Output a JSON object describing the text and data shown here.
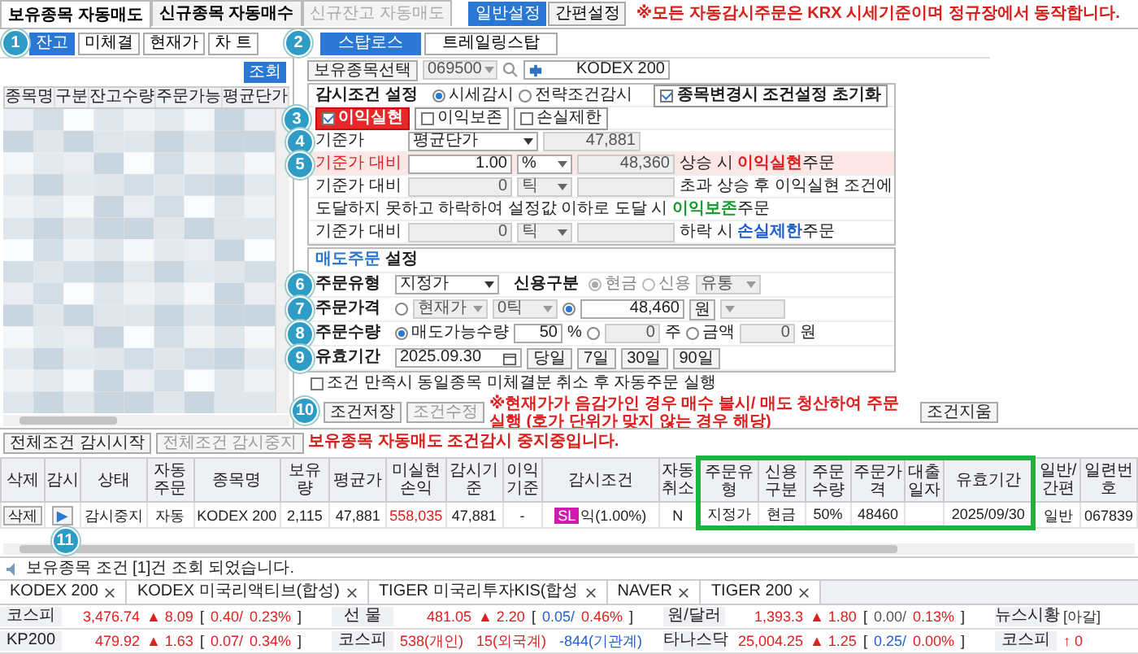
{
  "top_tabs": [
    {
      "label": "보유종목 자동매도",
      "selected": true,
      "disabled": false
    },
    {
      "label": "신규종목 자동매수",
      "selected": false,
      "disabled": false
    },
    {
      "label": "신규잔고 자동매도",
      "selected": false,
      "disabled": true
    }
  ],
  "mode_tabs": [
    {
      "label": "일반설정",
      "selected": true
    },
    {
      "label": "간편설정",
      "selected": false
    }
  ],
  "notice": "※모든 자동감시주문은 KRX 시세기준이며 정규장에서 동작합니다.",
  "left": {
    "tabs": [
      {
        "label": "잔고",
        "selected": true,
        "callout": "1"
      },
      {
        "label": "미체결",
        "selected": false
      },
      {
        "label": "현재가",
        "selected": false
      },
      {
        "label": "차 트",
        "selected": false
      }
    ],
    "query_button": "조회",
    "columns": [
      "종목명",
      "구분",
      "잔고수량",
      "주문가능",
      "평균단가"
    ]
  },
  "stop": {
    "tabs": [
      {
        "label": "스탑로스",
        "selected": true
      },
      {
        "label": "트레일링스탑",
        "selected": false
      }
    ],
    "tabs_callout": "2",
    "symbol": {
      "button": "보유종목선택",
      "code": "069500",
      "name": "KODEX 200"
    },
    "watch": {
      "title": "감시조건 설정",
      "modes": [
        {
          "label": "시세감시",
          "selected": true
        },
        {
          "label": "전략조건감시",
          "selected": false
        }
      ],
      "reset": {
        "label": "종목변경시 조건설정 초기화",
        "checked": true
      },
      "types_callout": "3",
      "types": [
        {
          "label": "이익실현",
          "checked": true
        },
        {
          "label": "이익보존",
          "checked": false
        },
        {
          "label": "손실제한",
          "checked": false
        }
      ],
      "base": {
        "callout": "4",
        "label": "기준가",
        "select": "평균단가",
        "value": "47,881"
      },
      "rows": [
        {
          "kind": "rule",
          "callout": "5",
          "active": true,
          "label": "기준가 대비",
          "value": "1.00",
          "unit": "%",
          "result": "48,360",
          "lead": "상승 시",
          "term": "이익실현",
          "tail": "주문",
          "color": "#e02020"
        },
        {
          "kind": "rule",
          "active": false,
          "label": "기준가 대비",
          "value": "0",
          "unit": "틱",
          "lead": "초과 상승 후 이익실현 조건에"
        },
        {
          "kind": "note",
          "lead": "도달하지 못하고 하락하여 설정값 이하로 도달 시",
          "term": "이익보존",
          "tail": "주문",
          "color": "#1a9a30"
        },
        {
          "kind": "rule",
          "active": false,
          "label": "기준가 대비",
          "value": "0",
          "unit": "틱",
          "lead": "하락 시",
          "term": "손실제한",
          "tail": "주문",
          "color": "#2060d0"
        }
      ]
    },
    "order": {
      "title_term": "매도주문",
      "title": "설정",
      "type": {
        "callout": "6",
        "label": "주문유형",
        "value": "지정가"
      },
      "credit": {
        "label": "신용구분",
        "options": [
          {
            "label": "현금",
            "selected": true
          },
          {
            "label": "신용",
            "selected": false
          }
        ],
        "select": "유통"
      },
      "price": {
        "callout": "7",
        "label": "주문가격",
        "market_selected": false,
        "market_select": "현재가",
        "tick_select": "0틱",
        "fixed_selected": true,
        "value": "48,460",
        "unit": "원"
      },
      "qty": {
        "callout": "8",
        "label": "주문수량",
        "sellable": {
          "label": "매도가능수량",
          "selected": true,
          "value": "50",
          "unit": "%"
        },
        "shares": {
          "selected": false,
          "value": "0",
          "unit": "주"
        },
        "amount": {
          "label": "금액",
          "selected": false,
          "value": "0",
          "unit": "원"
        }
      },
      "expiry": {
        "callout": "9",
        "label": "유효기간",
        "date": "2025.09.30",
        "presets": [
          "당일",
          "7일",
          "30일",
          "90일"
        ]
      }
    },
    "auto_cancel": {
      "label": "조건 만족시 동일종목 미체결분 취소 후 자동주문 실행",
      "checked": false
    },
    "actions": {
      "callout": "10",
      "save": "조건저장",
      "edit": "조건수정",
      "warning": "※현재가가 음감가인 경우 매수 불시/ 매도 청산하여 주문 실행 (호가 단위가 맞지 않는 경우 해당)",
      "clear": "조건지움"
    }
  },
  "monitor": {
    "start": "전체조건 감시시작",
    "stop": "전체조건 감시중지",
    "message": "보유종목 자동매도 조건감시 중지중입니다."
  },
  "conditions": {
    "columns": [
      {
        "label": "삭제",
        "highlighted": false
      },
      {
        "label": "감시",
        "highlighted": false
      },
      {
        "label": "상태",
        "highlighted": false
      },
      {
        "label": "자동주문",
        "highlighted": false
      },
      {
        "label": "종목명",
        "highlighted": false
      },
      {
        "label": "보유량",
        "highlighted": false
      },
      {
        "label": "평균가",
        "highlighted": false
      },
      {
        "label": "미실현손익",
        "highlighted": false
      },
      {
        "label": "감시기준",
        "highlighted": false
      },
      {
        "label": "이익기준",
        "highlighted": false
      },
      {
        "label": "감시조건",
        "highlighted": false
      },
      {
        "label": "자동취소",
        "highlighted": false
      },
      {
        "label": "주문유형",
        "highlighted": true
      },
      {
        "label": "신용구분",
        "highlighted": true
      },
      {
        "label": "주문수량",
        "highlighted": true
      },
      {
        "label": "주문가격",
        "highlighted": true
      },
      {
        "label": "대출일자",
        "highlighted": true
      },
      {
        "label": "유효기간",
        "highlighted": true
      },
      {
        "label": "일반/간편",
        "highlighted": false
      },
      {
        "label": "일련번호",
        "highlighted": false
      }
    ],
    "row": [
      {
        "kind": "button",
        "text": "삭제"
      },
      {
        "kind": "play",
        "text": "▶",
        "callout": "11"
      },
      {
        "kind": "text",
        "text": "감시중지"
      },
      {
        "kind": "text",
        "text": "자동"
      },
      {
        "kind": "text",
        "text": "KODEX 200"
      },
      {
        "kind": "text",
        "text": "2,115"
      },
      {
        "kind": "text",
        "text": "47,881"
      },
      {
        "kind": "text",
        "text": "558,035",
        "positive": true
      },
      {
        "kind": "text",
        "text": "47,881"
      },
      {
        "kind": "text",
        "text": "-"
      },
      {
        "kind": "tag",
        "tag": "SL",
        "text": "익(1.00%)"
      },
      {
        "kind": "text",
        "text": "N"
      },
      {
        "kind": "text",
        "text": "지정가"
      },
      {
        "kind": "text",
        "text": "현금"
      },
      {
        "kind": "text",
        "text": "50%"
      },
      {
        "kind": "text",
        "text": "48460"
      },
      {
        "kind": "empty"
      },
      {
        "kind": "text",
        "text": "2025/09/30"
      },
      {
        "kind": "text",
        "text": "일반"
      },
      {
        "kind": "text",
        "text": "067839"
      }
    ]
  },
  "status_message": "보유종목 조건 [1]건 조회 되었습니다.",
  "stock_tabs": [
    "KODEX 200",
    "KODEX 미국리액티브(합성)",
    "TIGER 미국리투자KIS(합성",
    "NAVER",
    "TIGER 200"
  ],
  "ticker": [
    {
      "items": [
        {
          "kind": "quote",
          "label": "코스피",
          "value": "3,476.74",
          "arrow": "▲",
          "change": "8.09",
          "bracket_open": "[",
          "figures": [
            {
              "text": "0.40/",
              "color": "#e02020"
            },
            {
              "text": "0.23%",
              "color": "#e02020"
            }
          ],
          "bracket_close": "]"
        },
        {
          "kind": "quote",
          "label": "선 물",
          "value": "481.05",
          "arrow": "▲",
          "change": "2.20",
          "bracket_open": "[",
          "figures": [
            {
              "text": "0.05/",
              "color": "#2060d0"
            },
            {
              "text": "0.46%",
              "color": "#e02020"
            }
          ],
          "bracket_close": "]"
        },
        {
          "kind": "quote",
          "label": "원/달러",
          "value": "1,393.3",
          "arrow": "▲",
          "change": "1.80",
          "bracket_open": "[",
          "figures": [
            {
              "text": "0.00/",
              "color": "#555555"
            },
            {
              "text": "0.13%",
              "color": "#e02020"
            }
          ],
          "bracket_close": "]"
        },
        {
          "kind": "news",
          "label": "뉴스시황",
          "value": "[아갈]"
        }
      ]
    },
    {
      "items": [
        {
          "kind": "quote",
          "label": "KP200",
          "value": "479.92",
          "arrow": "▲",
          "change": "1.63",
          "bracket_open": "[",
          "figures": [
            {
              "text": "0.07/",
              "color": "#e02020"
            },
            {
              "text": "0.34%",
              "color": "#e02020"
            }
          ],
          "bracket_close": "]"
        },
        {
          "kind": "flow",
          "label": "코스피",
          "parts": [
            {
              "text": "538(개인)",
              "color": "#e02020"
            },
            {
              "text": "15(외국계)",
              "color": "#e02020"
            },
            {
              "text": "-844(기관계)",
              "color": "#2060d0"
            }
          ]
        },
        {
          "kind": "quote",
          "label": "타나스닥",
          "value": "25,004.25",
          "arrow": "▲",
          "change": "1.25",
          "bracket_open": "[",
          "figures": [
            {
              "text": "0.25/",
              "color": "#2060d0"
            },
            {
              "text": "0.00%",
              "color": "#e02020"
            }
          ],
          "bracket_close": "]"
        },
        {
          "kind": "mini",
          "label": "코스피",
          "arrow": "↑",
          "change": "0"
        }
      ]
    }
  ]
}
